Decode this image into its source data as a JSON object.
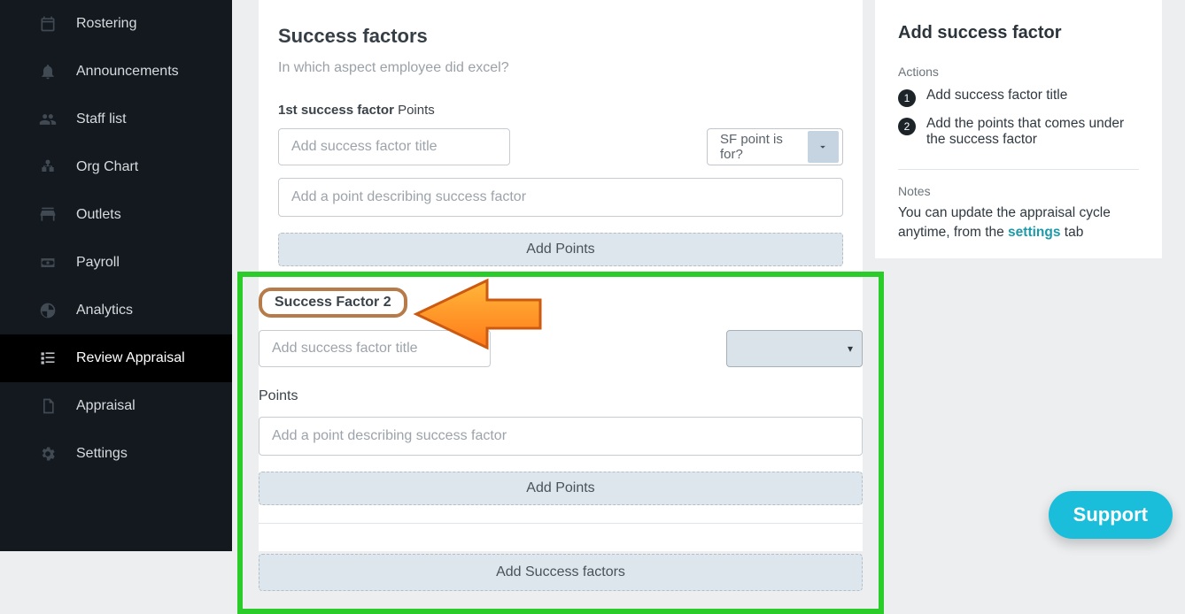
{
  "sidebar": {
    "items": [
      {
        "label": "Rostering"
      },
      {
        "label": "Announcements"
      },
      {
        "label": "Staff list"
      },
      {
        "label": "Org Chart"
      },
      {
        "label": "Outlets"
      },
      {
        "label": "Payroll"
      },
      {
        "label": "Analytics"
      },
      {
        "label": "Review Appraisal"
      },
      {
        "label": "Appraisal"
      },
      {
        "label": "Settings"
      }
    ],
    "active_index": 7
  },
  "main": {
    "title": "Success factors",
    "subtitle": "In which aspect employee did excel?",
    "sf1": {
      "label_prefix": "1st success factor",
      "label_suffix": " Points",
      "title_placeholder": "Add success factor title",
      "dropdown_text": "SF point is for?",
      "point_placeholder": "Add a point describing success factor",
      "add_points_btn": "Add Points"
    },
    "sf2": {
      "badge": "Success Factor 2",
      "title_placeholder": "Add success factor title",
      "points_label": "Points",
      "point_placeholder": "Add a point describing success factor",
      "add_points_btn": "Add Points",
      "add_sf_btn": "Add Success factors"
    }
  },
  "right": {
    "title": "Add success factor",
    "actions_label": "Actions",
    "actions": [
      "Add success factor title",
      "Add the points that comes under the success factor"
    ],
    "notes_label": "Notes",
    "notes_pre": "You can update the appraisal cycle anytime, from the ",
    "notes_link": "settings",
    "notes_post": " tab"
  },
  "support_label": "Support"
}
